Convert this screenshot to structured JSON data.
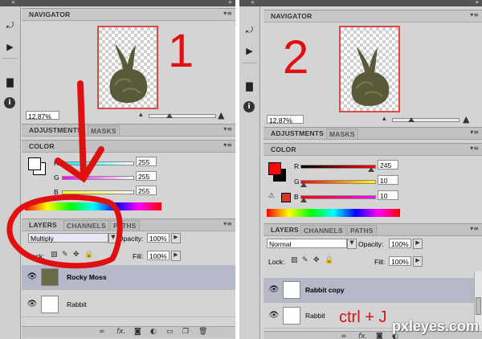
{
  "panels": [
    {
      "navigator": {
        "title": "NAVIGATOR",
        "zoom": "12.87%",
        "annotation_number": "1"
      },
      "adjustments": {
        "tab_active": "ADJUSTMENTS",
        "tab_inactive": "MASKS"
      },
      "color": {
        "title": "COLOR",
        "r": "255",
        "g": "255",
        "b": "255",
        "r_label": "R",
        "g_label": "G",
        "b_label": "B"
      },
      "layers": {
        "tab_layers": "LAYERS",
        "tab_channels": "CHANNELS",
        "tab_paths": "PATHS",
        "blend_mode": "Multiply",
        "opacity_label": "Opacity:",
        "opacity": "100%",
        "lock_label": "Lock:",
        "fill_label": "Fill:",
        "fill": "100%",
        "rows": [
          {
            "name": "Rocky Moss",
            "selected": true
          },
          {
            "name": "Rabbit",
            "selected": false
          }
        ]
      },
      "footer_fx": "fx."
    },
    {
      "navigator": {
        "title": "NAVIGATOR",
        "zoom": "12.87%",
        "annotation_number": "2"
      },
      "adjustments": {
        "tab_active": "ADJUSTMENTS",
        "tab_inactive": "MASKS"
      },
      "color": {
        "title": "COLOR",
        "r": "245",
        "g": "10",
        "b": "10",
        "r_label": "R",
        "g_label": "G",
        "b_label": "B"
      },
      "layers": {
        "tab_layers": "LAYERS",
        "tab_channels": "CHANNELS",
        "tab_paths": "PATHS",
        "blend_mode": "Normal",
        "opacity_label": "Opacity:",
        "opacity": "100%",
        "lock_label": "Lock:",
        "fill_label": "Fill:",
        "fill": "100%",
        "rows": [
          {
            "name": "Rabbit copy",
            "selected": true
          },
          {
            "name": "Rabbit",
            "selected": false
          }
        ]
      },
      "footer_fx": "fx.",
      "annotation_shortcut": "ctrl + J"
    }
  ],
  "watermark": "pxleyes.com",
  "colors": {
    "annotation": "#e01010",
    "selected_row": "#b4b8c8",
    "foreground_red": "#f50a0a",
    "foreground_white": "#ffffff"
  }
}
